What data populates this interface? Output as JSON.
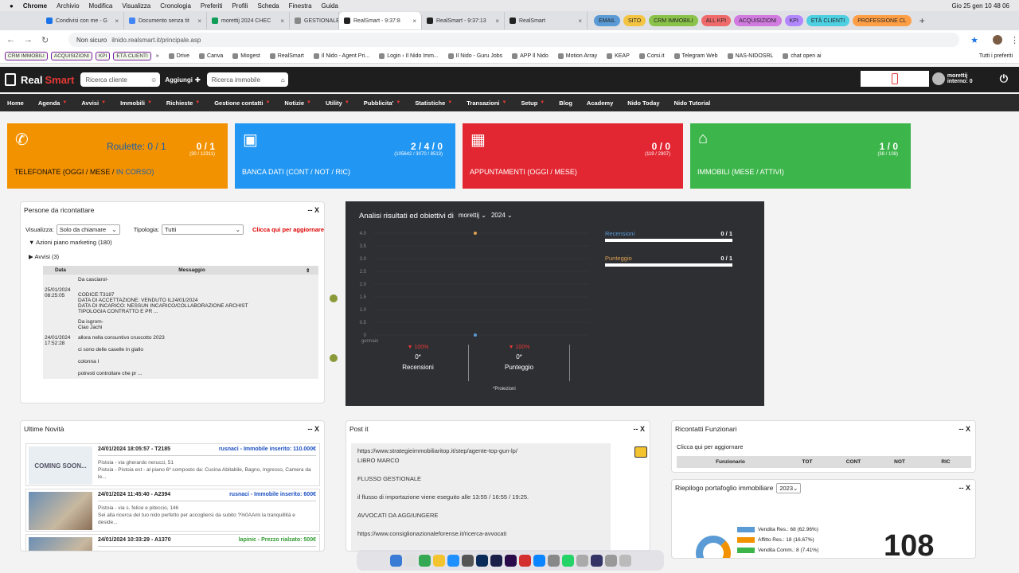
{
  "menubar": {
    "app": "Chrome",
    "items": [
      "Archivio",
      "Modifica",
      "Visualizza",
      "Cronologia",
      "Preferiti",
      "Profili",
      "Scheda",
      "Finestra",
      "Guida"
    ],
    "clock": "Gio 25 gen  10 48 06"
  },
  "tabs": [
    {
      "label": "Condivisi con me - G",
      "color": "#1a73e8"
    },
    {
      "label": "Documento senza tit",
      "color": "#4285f4"
    },
    {
      "label": "morettij 2024 CHEC",
      "color": "#0f9d58"
    },
    {
      "label": "GESTIONALE",
      "color": "#888",
      "chip": true
    },
    {
      "label": "RealSmart - 9:37:8",
      "color": "#222",
      "active": true
    },
    {
      "label": "RealSmart - 9:37:13",
      "color": "#222"
    },
    {
      "label": "RealSmart",
      "color": "#222"
    }
  ],
  "color_tabs": [
    {
      "label": "EMAIL",
      "bg": "#5b9bd5"
    },
    {
      "label": "SITO",
      "bg": "#f4c542"
    },
    {
      "label": "CRM IMMOBILI",
      "bg": "#8bc34a"
    },
    {
      "label": "ALL KPI",
      "bg": "#ef6a6a"
    },
    {
      "label": "ACQUISIZIONI",
      "bg": "#d17be0"
    },
    {
      "label": "KPI",
      "bg": "#b388ff"
    },
    {
      "label": "ETÀ CLIENTI",
      "bg": "#4dd0e1"
    },
    {
      "label": "PROFESSIONE CL",
      "bg": "#ff9f45"
    }
  ],
  "address": {
    "security": "Non sicuro",
    "url": "ilnido.realsmart.it/principale.asp"
  },
  "bookmarks": {
    "tags": [
      "CRM IMMOBILI",
      "ACQUISIZIONI",
      "KPI",
      "ETÀ CLIENTI"
    ],
    "items": [
      "Drive",
      "Canva",
      "Miogest",
      "RealSmart",
      "Il Nido - Agent Pri...",
      "Login ‹ Il Nido Imm...",
      "Il Nido - Guru Jobs",
      "APP Il Nido",
      "Motion Array",
      "KEAP",
      "Corsi.it",
      "Telegram Web",
      "NAS-NIDOSRL",
      "chat open ai"
    ],
    "all": "Tutti i preferiti"
  },
  "header": {
    "logo1": "Real",
    "logo2": "Smart",
    "search_client": "Ricerca cliente",
    "add": "Aggiungi",
    "search_property": "Ricerca immobile",
    "user": "morettij",
    "user_sub": "interno: 0"
  },
  "nav": [
    {
      "label": "Home",
      "caret": false
    },
    {
      "label": "Agenda",
      "caret": true
    },
    {
      "label": "Avvisi",
      "caret": true
    },
    {
      "label": "Immobili",
      "caret": true
    },
    {
      "label": "Richieste",
      "caret": true
    },
    {
      "label": "Gestione contatti",
      "caret": true
    },
    {
      "label": "Notizie",
      "caret": true
    },
    {
      "label": "Utility",
      "caret": true
    },
    {
      "label": "Pubblicita'",
      "caret": true
    },
    {
      "label": "Statistiche",
      "caret": true
    },
    {
      "label": "Transazioni",
      "caret": true
    },
    {
      "label": "Setup",
      "caret": true
    },
    {
      "label": "Blog",
      "caret": false
    },
    {
      "label": "Academy",
      "caret": false
    },
    {
      "label": "Nido Today",
      "caret": false
    },
    {
      "label": "Nido Tutorial",
      "caret": false
    }
  ],
  "tiles": {
    "t1": {
      "label_a": "TELEFONATE (OGGI / MESE / ",
      "label_b": "IN CORSO)",
      "roulette": "Roulette: 0 / 1",
      "value": "0 / 1",
      "sub": "(30 / 12311)",
      "color": "#f39200"
    },
    "t2": {
      "label": "BANCA DATI (CONT / NOT / RIC)",
      "value": "2 / 4 / 0",
      "sub": "(105642 / 3070 / 8513)",
      "color": "#2196f3"
    },
    "t3": {
      "label": "APPUNTAMENTI (OGGI / MESE)",
      "value": "0 / 0",
      "sub": "(119 / 2907)",
      "color": "#e32732"
    },
    "t4": {
      "label": "IMMOBILI (MESE / ATTIVI)",
      "value": "1 / 0",
      "sub": "(38 / 108)",
      "color": "#3cb54a"
    }
  },
  "recontact": {
    "title": "Persone da ricontattare",
    "ctl": "--  X",
    "vis_label": "Visualizza:",
    "vis_value": "Solo da chiamare",
    "tip_label": "Tipologia:",
    "tip_value": "Tutti",
    "refresh": "Clicca qui per aggiornare",
    "group1": "Azioni piano marketing (180)",
    "group2": "Avvisi (3)",
    "col_date": "Data",
    "col_msg": "Messaggio",
    "rows": [
      {
        "date": "",
        "lines": [
          "Da casciarol-"
        ]
      },
      {
        "date": "25/01/2024 08:25:05",
        "lines": [
          "CODICE:T3187",
          "DATA DI ACCETTAZIONE: VENDUTO IL24/01/2024",
          "DATA DI INCARICO: NESSUN INCARICO/COLLABORAZIONE ARCHIST",
          "TIPOLOGIA CONTRATTO E PR ..."
        ]
      },
      {
        "date": "",
        "lines": [
          "Da isgrom-",
          "Ciao Jachi"
        ]
      },
      {
        "date": "24/01/2024 17:52:28",
        "lines": [
          "allora nella consuntivo cruscotto 2023",
          "ci sono delle caselle in giallo",
          "colonna I",
          "potresti controllare che pr ..."
        ]
      }
    ]
  },
  "analysis": {
    "title": "Analisi risultati ed obiettivi di",
    "user": "morettij",
    "year": "2024",
    "legend": [
      {
        "name": "Recensioni",
        "value": "0 / 1",
        "color": "#5b9bd5"
      },
      {
        "name": "Punteggio",
        "value": "0 / 1",
        "color": "#e0a050"
      }
    ],
    "month": "gennaio",
    "stats": [
      {
        "pct": "100%",
        "val": "0*",
        "name": "Recensioni"
      },
      {
        "pct": "100%",
        "val": "0*",
        "name": "Punteggio"
      }
    ],
    "note": "*Proiezioni"
  },
  "chart_data": {
    "type": "line",
    "categories": [
      "gennaio"
    ],
    "ylim": [
      0,
      4
    ],
    "yticks": [
      "4.0",
      "3.5",
      "3.0",
      "2.5",
      "2.0",
      "1.5",
      "1.0",
      "0.5",
      "0"
    ],
    "series": [
      {
        "name": "Recensioni",
        "values": [
          0
        ],
        "color": "#5b9bd5"
      },
      {
        "name": "Punteggio",
        "values": [
          4
        ],
        "color": "#e0a050"
      }
    ]
  },
  "news": {
    "title": "Ultime Novità",
    "ctl": "--  X",
    "rows": [
      {
        "head": "24/01/2024 18:05:57 - T2185",
        "tag": "rusnaci - Immobile inserito: 110.000€",
        "tag_color": "#1a4fc0",
        "lines": [
          "Pistoia - via gherardo nerucci, 51",
          "Pistoia - Pistoia est - al piano 6º composto da: Cucina Abitabile, Bagno, Ingresso, Camera da le..."
        ],
        "img": "coming"
      },
      {
        "head": "24/01/2024 11:45:40 - A2394",
        "tag": "rusnaci - Immobile inserito: 600€",
        "tag_color": "#1a4fc0",
        "lines": [
          "Pistoia - via s. felice e piteccio, 146",
          "Sei alla ricerca del tuo nido perfetto per accogliersi da subito ?%0AAmi la tranquillità e deside..."
        ],
        "img": "room"
      },
      {
        "head": "24/01/2024 10:33:29 - A1370",
        "tag": "lapinic - Prezzo rialzato: 500€",
        "tag_color": "#2e9a2e",
        "lines": [],
        "img": "room2"
      }
    ],
    "coming_soon": "COMING SOON..."
  },
  "postit": {
    "title": "Post it",
    "ctl": "--  X",
    "lines": [
      "https://www.strategieimmobiliaritop.it/step/agente-top-gun-lp/",
      "LIBRO MARCO",
      "",
      "FLUSSO GESTIONALE",
      "",
      "il flusso di importazione viene eseguito alle 13:55 / 16:55 / 19:25.",
      "",
      "AVVOCATI DA AGGIUNGERE",
      "",
      "https://www.consiglionazionaleforense.it/ricerca-avvocati"
    ]
  },
  "funz": {
    "title": "Ricontatti Funzionari",
    "ctl": "--  X",
    "refresh": "Clicca qui per aggiornare",
    "cols": [
      "Funzionario",
      "TOT",
      "CONT",
      "NOT",
      "RIC"
    ]
  },
  "portfolio": {
    "title": "Riepilogo portafoglio immobiliare",
    "year": "2023",
    "ctl": "--  X",
    "legend": [
      {
        "label": "Vendita Res.: 68 (62.96%)",
        "color": "#5b9bd5"
      },
      {
        "label": "Affitto Res.: 18 (16.67%)",
        "color": "#f39200"
      },
      {
        "label": "Vendita Comm.: 8 (7.41%)",
        "color": "#3cb54a"
      }
    ],
    "total": "108"
  }
}
